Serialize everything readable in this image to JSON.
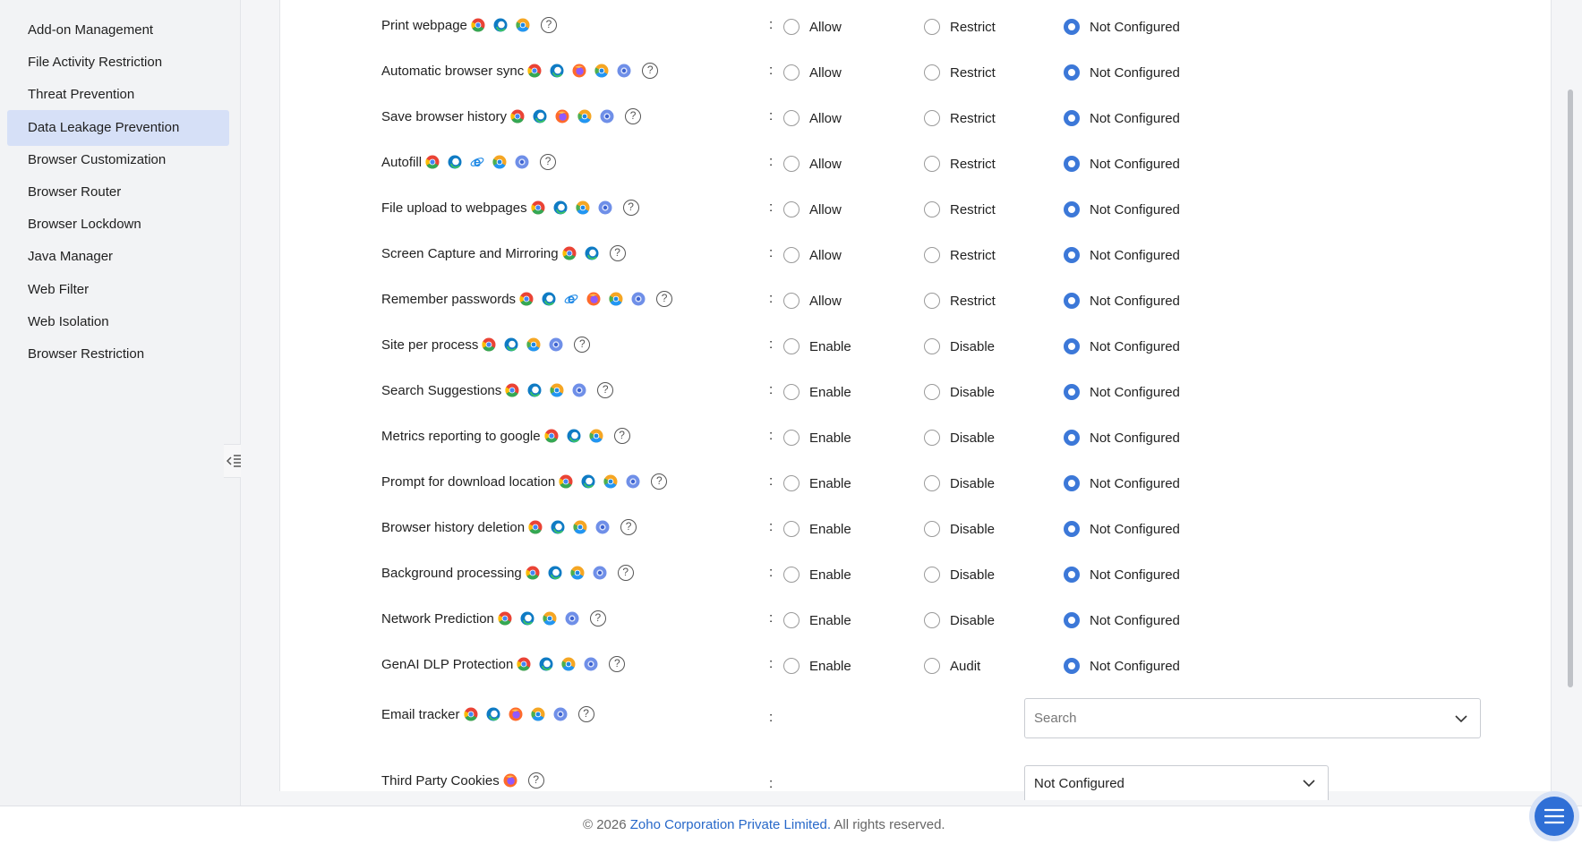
{
  "sidebar": {
    "items": [
      {
        "label": "Add-on Management",
        "active": false
      },
      {
        "label": "File Activity Restriction",
        "active": false
      },
      {
        "label": "Threat Prevention",
        "active": false
      },
      {
        "label": "Data Leakage Prevention",
        "active": true
      },
      {
        "label": "Browser Customization",
        "active": false
      },
      {
        "label": "Browser Router",
        "active": false
      },
      {
        "label": "Browser Lockdown",
        "active": false
      },
      {
        "label": "Java Manager",
        "active": false
      },
      {
        "label": "Web Filter",
        "active": false
      },
      {
        "label": "Web Isolation",
        "active": false
      },
      {
        "label": "Browser Restriction",
        "active": false
      }
    ],
    "collapse_icon": "collapse-sidebar-icon"
  },
  "settings": {
    "colon": ":",
    "help_glyph": "?",
    "rows": [
      {
        "label": "Print webpage",
        "browsers": [
          "chrome",
          "edge",
          "chromium"
        ],
        "options": [
          "Allow",
          "Restrict",
          "Not Configured"
        ],
        "selected": 2
      },
      {
        "label": "Automatic browser sync",
        "browsers": [
          "chrome",
          "edge",
          "firefox",
          "chromium",
          "brave"
        ],
        "options": [
          "Allow",
          "Restrict",
          "Not Configured"
        ],
        "selected": 2
      },
      {
        "label": "Save browser history",
        "browsers": [
          "chrome",
          "edge",
          "firefox",
          "chromium",
          "brave"
        ],
        "options": [
          "Allow",
          "Restrict",
          "Not Configured"
        ],
        "selected": 2
      },
      {
        "label": "Autofill",
        "browsers": [
          "chrome",
          "edge",
          "ie",
          "chromium",
          "brave"
        ],
        "options": [
          "Allow",
          "Restrict",
          "Not Configured"
        ],
        "selected": 2
      },
      {
        "label": "File upload to webpages",
        "browsers": [
          "chrome",
          "edge",
          "chromium",
          "brave"
        ],
        "options": [
          "Allow",
          "Restrict",
          "Not Configured"
        ],
        "selected": 2
      },
      {
        "label": "Screen Capture and Mirroring",
        "browsers": [
          "chrome",
          "edge"
        ],
        "options": [
          "Allow",
          "Restrict",
          "Not Configured"
        ],
        "selected": 2
      },
      {
        "label": "Remember passwords",
        "browsers": [
          "chrome",
          "edge",
          "ie",
          "firefox",
          "chromium",
          "brave"
        ],
        "options": [
          "Allow",
          "Restrict",
          "Not Configured"
        ],
        "selected": 2
      },
      {
        "label": "Site per process",
        "browsers": [
          "chrome",
          "edge",
          "chromium",
          "brave"
        ],
        "options": [
          "Enable",
          "Disable",
          "Not Configured"
        ],
        "selected": 2
      },
      {
        "label": "Search Suggestions",
        "browsers": [
          "chrome",
          "edge",
          "chromium",
          "brave"
        ],
        "options": [
          "Enable",
          "Disable",
          "Not Configured"
        ],
        "selected": 2
      },
      {
        "label": "Metrics reporting to google",
        "browsers": [
          "chrome",
          "edge",
          "chromium"
        ],
        "options": [
          "Enable",
          "Disable",
          "Not Configured"
        ],
        "selected": 2
      },
      {
        "label": "Prompt for download location",
        "browsers": [
          "chrome",
          "edge",
          "chromium",
          "brave"
        ],
        "options": [
          "Enable",
          "Disable",
          "Not Configured"
        ],
        "selected": 2
      },
      {
        "label": "Browser history deletion",
        "browsers": [
          "chrome",
          "edge",
          "chromium",
          "brave"
        ],
        "options": [
          "Enable",
          "Disable",
          "Not Configured"
        ],
        "selected": 2
      },
      {
        "label": "Background processing",
        "browsers": [
          "chrome",
          "edge",
          "chromium",
          "brave"
        ],
        "options": [
          "Enable",
          "Disable",
          "Not Configured"
        ],
        "selected": 2
      },
      {
        "label": "Network Prediction",
        "browsers": [
          "chrome",
          "edge",
          "chromium",
          "brave"
        ],
        "options": [
          "Enable",
          "Disable",
          "Not Configured"
        ],
        "selected": 2
      },
      {
        "label": "GenAI DLP Protection",
        "browsers": [
          "chrome",
          "edge",
          "chromium",
          "brave"
        ],
        "options": [
          "Enable",
          "Audit",
          "Not Configured"
        ],
        "selected": 2
      }
    ],
    "email_tracker": {
      "label": "Email tracker",
      "browsers": [
        "chrome",
        "edge",
        "firefox",
        "chromium",
        "brave"
      ],
      "placeholder": "Search"
    },
    "third_party_cookies": {
      "label": "Third Party Cookies",
      "browsers": [
        "firefox"
      ],
      "value": "Not Configured"
    }
  },
  "footer": {
    "prefix": "© 2026 ",
    "company": "Zoho Corporation Private Limited.",
    "suffix": " All rights reserved."
  },
  "colors": {
    "accent": "#3c78d8",
    "active_bg": "#d6e0f7",
    "link": "#2768c9"
  }
}
